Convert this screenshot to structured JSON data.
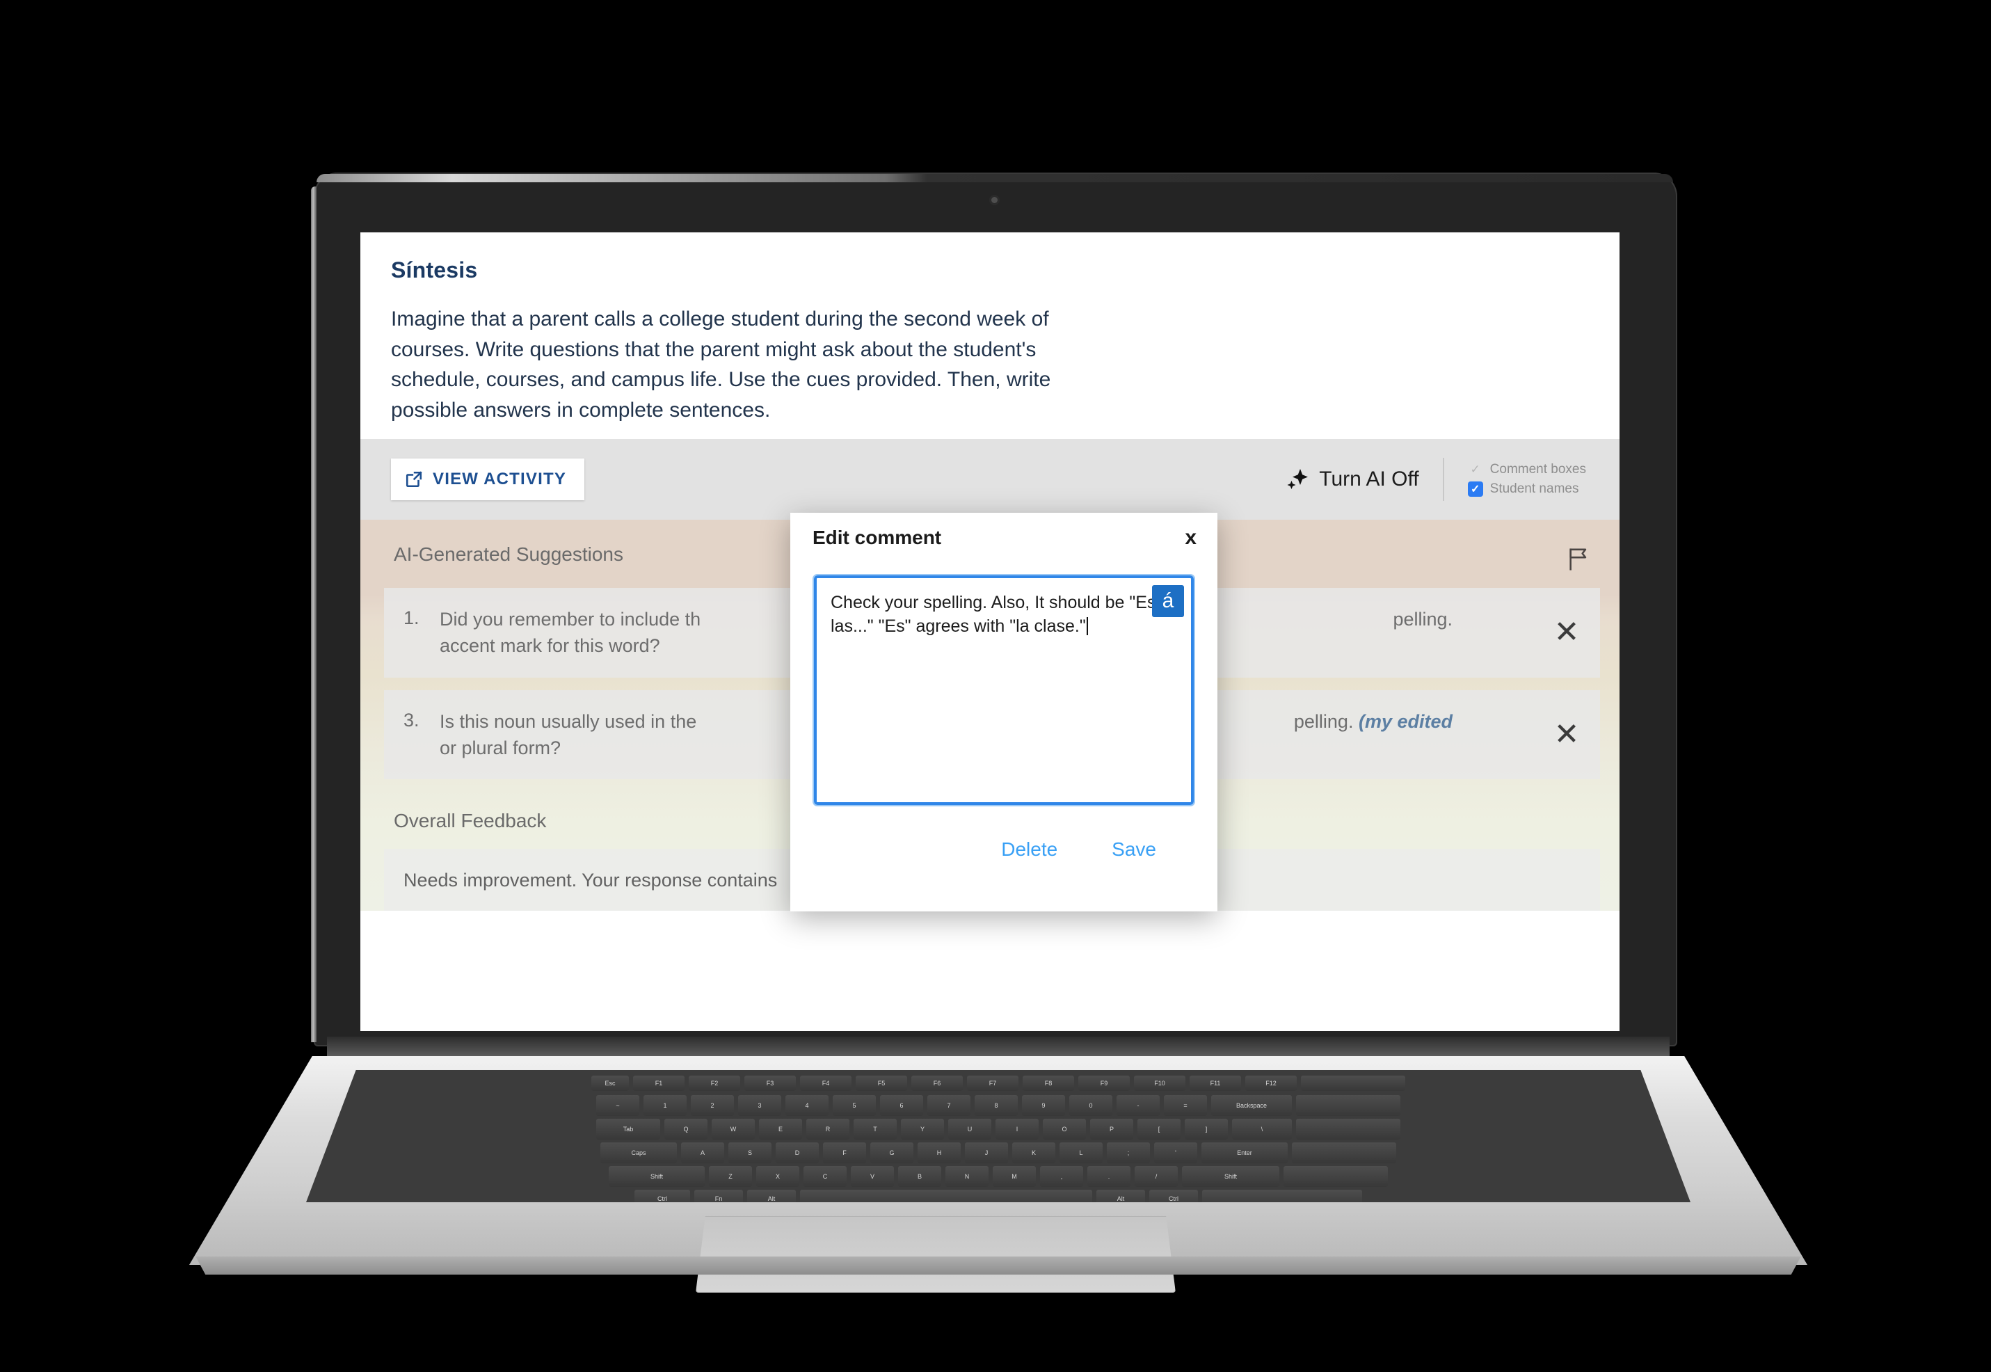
{
  "prompt": {
    "title": "Síntesis",
    "body": "Imagine that a parent calls a college student during the second week of courses. Write questions that the parent might ask about the student's schedule, courses, and campus life. Use the cues provided. Then, write possible answers in complete sentences."
  },
  "toolbar": {
    "view_activity_label": "VIEW ACTIVITY",
    "ai_toggle_label": "Turn AI Off",
    "checkboxes": [
      {
        "label": "Comment boxes",
        "checked": false
      },
      {
        "label": "Student names",
        "checked": true
      }
    ]
  },
  "feedback": {
    "suggestions_heading": "AI-Generated Suggestions",
    "suggestions": [
      {
        "number": "1.",
        "text": "Did you remember to include th",
        "text_right": "pelling.",
        "full_text": "Did you remember to include the accent mark for this word?",
        "line2": "accent mark for this word?",
        "edited_note": ""
      },
      {
        "number": "3.",
        "text": "Is this noun usually used in the",
        "text_right": "pelling.",
        "full_text": "Is this noun usually used in the singular or plural form?",
        "line2": "or plural form?",
        "edited_note": "(my edited"
      }
    ],
    "overall_heading": "Overall Feedback",
    "overall_text": "Needs improvement. Your response contains"
  },
  "modal": {
    "title": "Edit comment",
    "close_label": "x",
    "comment_text": "Check your spelling. Also, It should be \"Es a las...\" \"Es\" agrees with \"la clase.\"",
    "accent_button_label": "á",
    "delete_label": "Delete",
    "save_label": "Save"
  },
  "colors": {
    "accent_blue": "#1d4f91",
    "link_blue": "#39a0f5",
    "checkbox_blue": "#2b7bf3",
    "focus_blue": "#2f86e8",
    "edited_blue": "#5c7fa3",
    "panel_top": "#e3d4c8",
    "panel_bottom": "#eef1e6"
  }
}
